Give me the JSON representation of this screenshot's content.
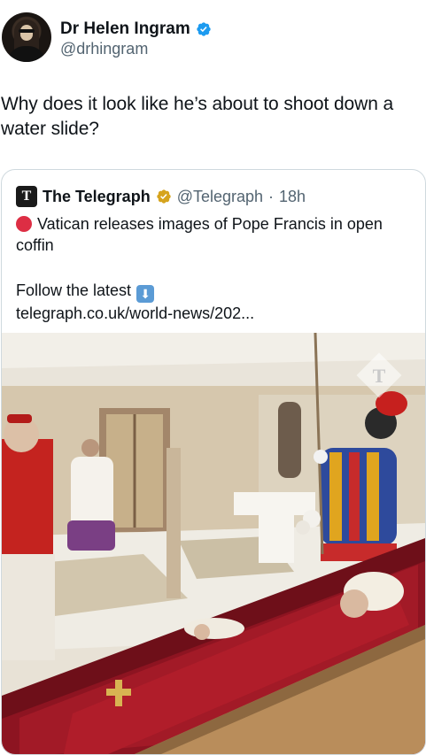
{
  "author": {
    "display_name": "Dr Helen Ingram",
    "handle": "@drhingram"
  },
  "tweet": {
    "text": "Why does it look like he’s about to shoot down a water slide?"
  },
  "quoted": {
    "logo_letter": "T",
    "name": "The Telegraph",
    "handle": "@Telegraph",
    "separator": "·",
    "time": "18h",
    "headline": "Vatican releases images of Pope Francis in open coffin",
    "follow_text": "Follow the latest",
    "link": "telegraph.co.uk/world-news/202...",
    "watermark_letter": "T"
  },
  "colors": {
    "verified_blue": "#1d9bf0",
    "gold_badge": "#d6a41e",
    "secondary_text": "#536471",
    "border": "#cfd9de"
  },
  "icons": {
    "verified": "verified-badge-icon",
    "gold_verified": "gold-verified-badge-icon",
    "red_circle": "red-circle-emoji",
    "down_arrow": "down-arrow-emoji"
  }
}
